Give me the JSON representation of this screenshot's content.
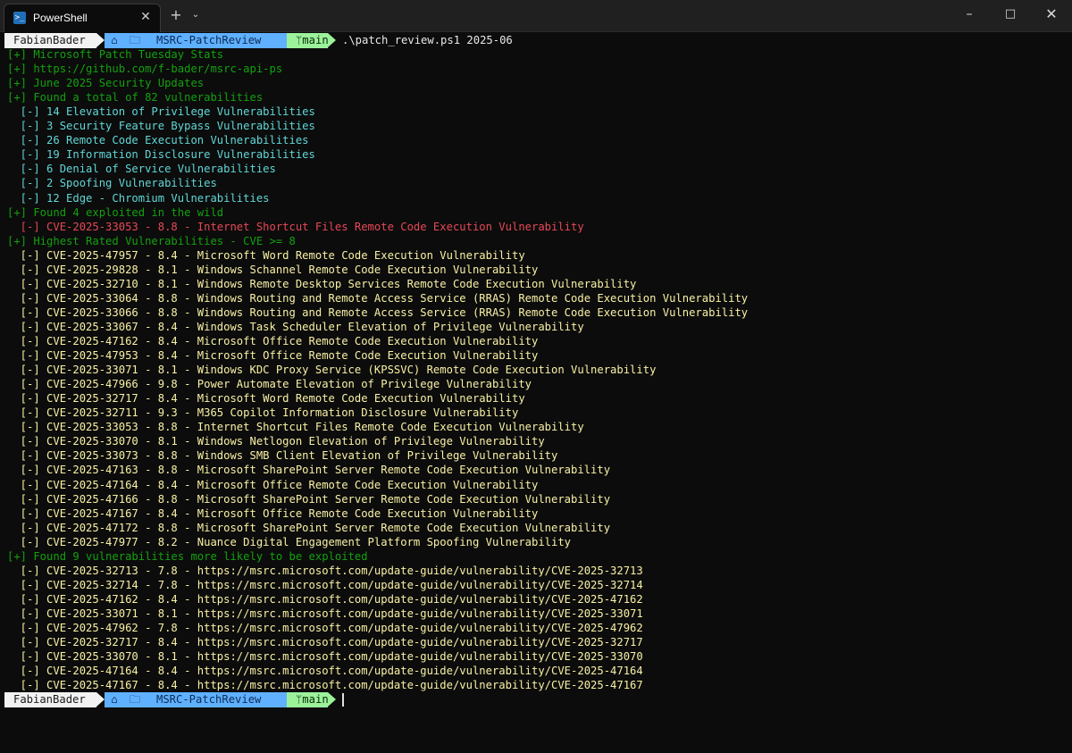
{
  "window": {
    "tab_title": "PowerShell",
    "tab_icon_glyph": ">_",
    "close_glyph": "✕",
    "new_tab_glyph": "+",
    "dropdown_glyph": "⌄",
    "minimize_glyph": "–",
    "maximize_glyph": "□",
    "window_close_glyph": "✕"
  },
  "prompt": {
    "user": "FabianBader",
    "home_glyph": "⌂",
    "folder_glyph": "🗁",
    "path": "MSRC-PatchReview",
    "branch": "ᛘmain",
    "command": ".\\patch_review.ps1 2025-06"
  },
  "colors": {
    "background": "#0c0c0c",
    "header_green": "#13a10e",
    "category_cyan": "#61d6d6",
    "exploited_red": "#e74856",
    "cve_yellow": "#f9f1a5",
    "segment_user": "#f2f2f2",
    "segment_path": "#5fb0ff",
    "segment_git": "#9cf29a"
  },
  "output": [
    {
      "text": "[+] Microsoft Patch Tuesday Stats",
      "color": "green"
    },
    {
      "text": "[+] https://github.com/f-bader/msrc-api-ps",
      "color": "green"
    },
    {
      "text": "[+] June 2025 Security Updates",
      "color": "green"
    },
    {
      "text": "[+] Found a total of 82 vulnerabilities",
      "color": "green"
    },
    {
      "text": "  [-] 14 Elevation of Privilege Vulnerabilities",
      "color": "cyan"
    },
    {
      "text": "  [-] 3 Security Feature Bypass Vulnerabilities",
      "color": "cyan"
    },
    {
      "text": "  [-] 26 Remote Code Execution Vulnerabilities",
      "color": "cyan"
    },
    {
      "text": "  [-] 19 Information Disclosure Vulnerabilities",
      "color": "cyan"
    },
    {
      "text": "  [-] 6 Denial of Service Vulnerabilities",
      "color": "cyan"
    },
    {
      "text": "  [-] 2 Spoofing Vulnerabilities",
      "color": "cyan"
    },
    {
      "text": "  [-] 12 Edge - Chromium Vulnerabilities",
      "color": "cyan"
    },
    {
      "text": "[+] Found 4 exploited in the wild",
      "color": "green"
    },
    {
      "text": "  [-] CVE-2025-33053 - 8.8 - Internet Shortcut Files Remote Code Execution Vulnerability",
      "color": "red"
    },
    {
      "text": "[+] Highest Rated Vulnerabilities - CVE >= 8",
      "color": "green"
    },
    {
      "text": "  [-] CVE-2025-47957 - 8.4 - Microsoft Word Remote Code Execution Vulnerability",
      "color": "yellow"
    },
    {
      "text": "  [-] CVE-2025-29828 - 8.1 - Windows Schannel Remote Code Execution Vulnerability",
      "color": "yellow"
    },
    {
      "text": "  [-] CVE-2025-32710 - 8.1 - Windows Remote Desktop Services Remote Code Execution Vulnerability",
      "color": "yellow"
    },
    {
      "text": "  [-] CVE-2025-33064 - 8.8 - Windows Routing and Remote Access Service (RRAS) Remote Code Execution Vulnerability",
      "color": "yellow"
    },
    {
      "text": "  [-] CVE-2025-33066 - 8.8 - Windows Routing and Remote Access Service (RRAS) Remote Code Execution Vulnerability",
      "color": "yellow"
    },
    {
      "text": "  [-] CVE-2025-33067 - 8.4 - Windows Task Scheduler Elevation of Privilege Vulnerability",
      "color": "yellow"
    },
    {
      "text": "  [-] CVE-2025-47162 - 8.4 - Microsoft Office Remote Code Execution Vulnerability",
      "color": "yellow"
    },
    {
      "text": "  [-] CVE-2025-47953 - 8.4 - Microsoft Office Remote Code Execution Vulnerability",
      "color": "yellow"
    },
    {
      "text": "  [-] CVE-2025-33071 - 8.1 - Windows KDC Proxy Service (KPSSVC) Remote Code Execution Vulnerability",
      "color": "yellow"
    },
    {
      "text": "  [-] CVE-2025-47966 - 9.8 - Power Automate Elevation of Privilege Vulnerability",
      "color": "yellow"
    },
    {
      "text": "  [-] CVE-2025-32717 - 8.4 - Microsoft Word Remote Code Execution Vulnerability",
      "color": "yellow"
    },
    {
      "text": "  [-] CVE-2025-32711 - 9.3 - M365 Copilot Information Disclosure Vulnerability",
      "color": "yellow"
    },
    {
      "text": "  [-] CVE-2025-33053 - 8.8 - Internet Shortcut Files Remote Code Execution Vulnerability",
      "color": "yellow"
    },
    {
      "text": "  [-] CVE-2025-33070 - 8.1 - Windows Netlogon Elevation of Privilege Vulnerability",
      "color": "yellow"
    },
    {
      "text": "  [-] CVE-2025-33073 - 8.8 - Windows SMB Client Elevation of Privilege Vulnerability",
      "color": "yellow"
    },
    {
      "text": "  [-] CVE-2025-47163 - 8.8 - Microsoft SharePoint Server Remote Code Execution Vulnerability",
      "color": "yellow"
    },
    {
      "text": "  [-] CVE-2025-47164 - 8.4 - Microsoft Office Remote Code Execution Vulnerability",
      "color": "yellow"
    },
    {
      "text": "  [-] CVE-2025-47166 - 8.8 - Microsoft SharePoint Server Remote Code Execution Vulnerability",
      "color": "yellow"
    },
    {
      "text": "  [-] CVE-2025-47167 - 8.4 - Microsoft Office Remote Code Execution Vulnerability",
      "color": "yellow"
    },
    {
      "text": "  [-] CVE-2025-47172 - 8.8 - Microsoft SharePoint Server Remote Code Execution Vulnerability",
      "color": "yellow"
    },
    {
      "text": "  [-] CVE-2025-47977 - 8.2 - Nuance Digital Engagement Platform Spoofing Vulnerability",
      "color": "yellow"
    },
    {
      "text": "[+] Found 9 vulnerabilities more likely to be exploited",
      "color": "green"
    },
    {
      "text": "  [-] CVE-2025-32713 - 7.8 - https://msrc.microsoft.com/update-guide/vulnerability/CVE-2025-32713",
      "color": "yellow"
    },
    {
      "text": "  [-] CVE-2025-32714 - 7.8 - https://msrc.microsoft.com/update-guide/vulnerability/CVE-2025-32714",
      "color": "yellow"
    },
    {
      "text": "  [-] CVE-2025-47162 - 8.4 - https://msrc.microsoft.com/update-guide/vulnerability/CVE-2025-47162",
      "color": "yellow"
    },
    {
      "text": "  [-] CVE-2025-33071 - 8.1 - https://msrc.microsoft.com/update-guide/vulnerability/CVE-2025-33071",
      "color": "yellow"
    },
    {
      "text": "  [-] CVE-2025-47962 - 7.8 - https://msrc.microsoft.com/update-guide/vulnerability/CVE-2025-47962",
      "color": "yellow"
    },
    {
      "text": "  [-] CVE-2025-32717 - 8.4 - https://msrc.microsoft.com/update-guide/vulnerability/CVE-2025-32717",
      "color": "yellow"
    },
    {
      "text": "  [-] CVE-2025-33070 - 8.1 - https://msrc.microsoft.com/update-guide/vulnerability/CVE-2025-33070",
      "color": "yellow"
    },
    {
      "text": "  [-] CVE-2025-47164 - 8.4 - https://msrc.microsoft.com/update-guide/vulnerability/CVE-2025-47164",
      "color": "yellow"
    },
    {
      "text": "  [-] CVE-2025-47167 - 8.4 - https://msrc.microsoft.com/update-guide/vulnerability/CVE-2025-47167",
      "color": "yellow"
    }
  ]
}
